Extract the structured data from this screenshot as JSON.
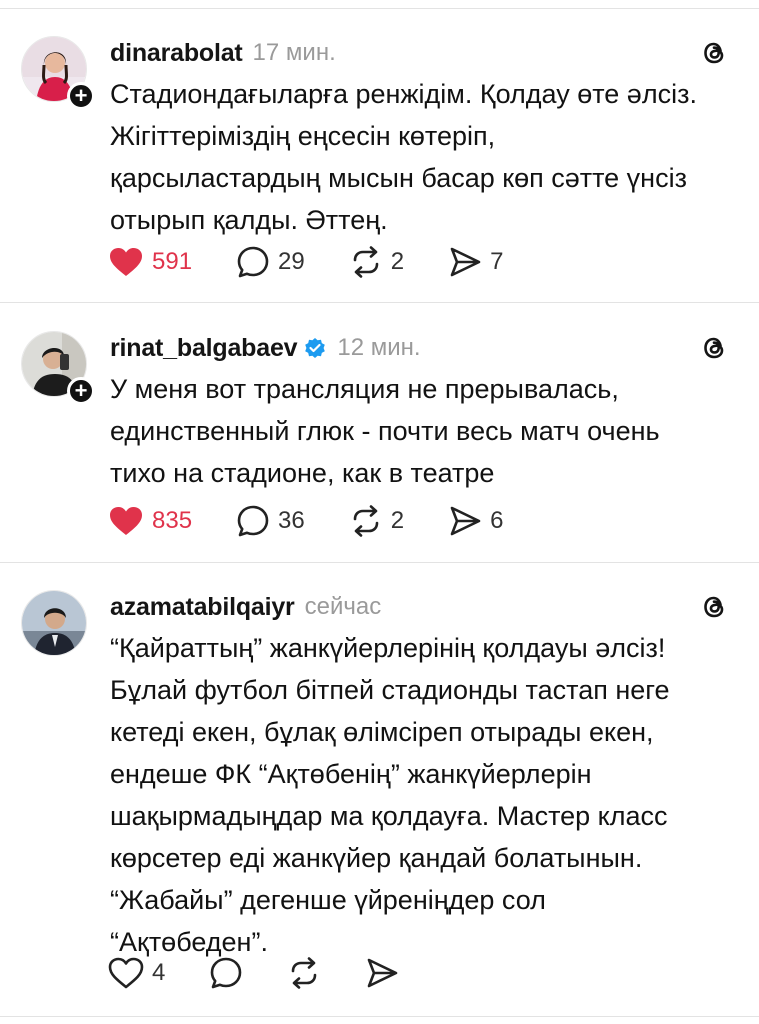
{
  "posts": [
    {
      "username": "dinarabolat",
      "verified": false,
      "time": "17 мин.",
      "text_lines": [
        "Стадиондағыларға ренжідім. Қолдау өте әлсіз.",
        "Жігіттеріміздің еңсесін көтеріп,",
        "қарсыластардың мысын басар көп сәтте үнсіз",
        "отырып қалды. Әттең."
      ],
      "likes": "591",
      "liked": true,
      "comments": "29",
      "reposts": "2",
      "shares": "7"
    },
    {
      "username": "rinat_balgabaev",
      "verified": true,
      "time": "12 мин.",
      "text_lines": [
        "У меня вот трансляция не прерывалась,",
        "единственный глюк - почти весь матч очень",
        "тихо на стадионе, как в театре"
      ],
      "likes": "835",
      "liked": true,
      "comments": "36",
      "reposts": "2",
      "shares": "6"
    },
    {
      "username": "azamatabilqaiyr",
      "verified": false,
      "time": "сейчас",
      "text_lines": [
        "“Қайраттың” жанкүйерлерінің қолдауы әлсіз!",
        "Бұлай футбол бітпей стадионды тастап неге",
        "кетеді екен, бұлақ өлімсіреп отырады екен,",
        "ендеше ФК “Ақтөбенің” жанкүйерлерін",
        "шақырмадыңдар ма қолдауға. Мастер класс",
        "көрсетер еді жанкүйер қандай болатынын.",
        "“Жабайы” дегенше үйреніңдер сол",
        "“Ақтөбеден”."
      ],
      "likes": "4",
      "liked": false,
      "comments": "",
      "reposts": "",
      "shares": ""
    }
  ],
  "colors": {
    "like_active": "#e0334b",
    "muted": "#9a9a9a",
    "verified": "#1d9bf0"
  },
  "icons": [
    "plus-icon",
    "threads-icon",
    "heart-icon",
    "comment-icon",
    "repost-icon",
    "share-icon",
    "verified-icon"
  ]
}
